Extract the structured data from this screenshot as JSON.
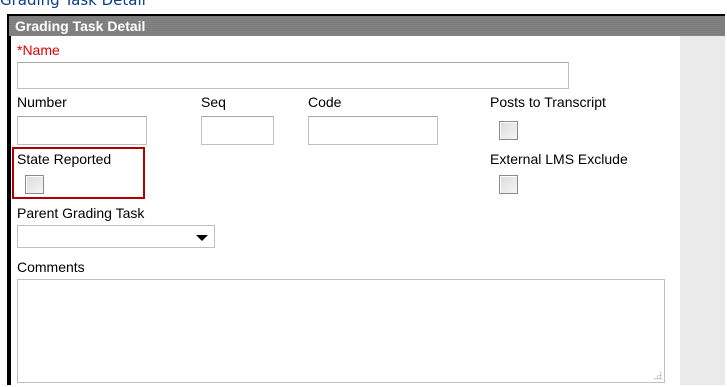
{
  "page": {
    "top_text": "Grading Task Detail"
  },
  "panel": {
    "title": "Grading Task Detail"
  },
  "form": {
    "name_label": "*Name",
    "name_value": "",
    "number_label": "Number",
    "number_value": "",
    "seq_label": "Seq",
    "seq_value": "",
    "code_label": "Code",
    "code_value": "",
    "posts_to_transcript_label": "Posts to Transcript",
    "posts_to_transcript_checked": false,
    "state_reported_label": "State Reported",
    "state_reported_checked": false,
    "external_lms_exclude_label": "External LMS Exclude",
    "external_lms_exclude_checked": false,
    "parent_grading_task_label": "Parent Grading Task",
    "parent_grading_task_value": "",
    "comments_label": "Comments",
    "comments_value": ""
  },
  "colors": {
    "header_bg": "#7c7c7c",
    "required_label": "#e00000",
    "highlight_border": "#b00000",
    "top_text": "#0a3f8a"
  }
}
